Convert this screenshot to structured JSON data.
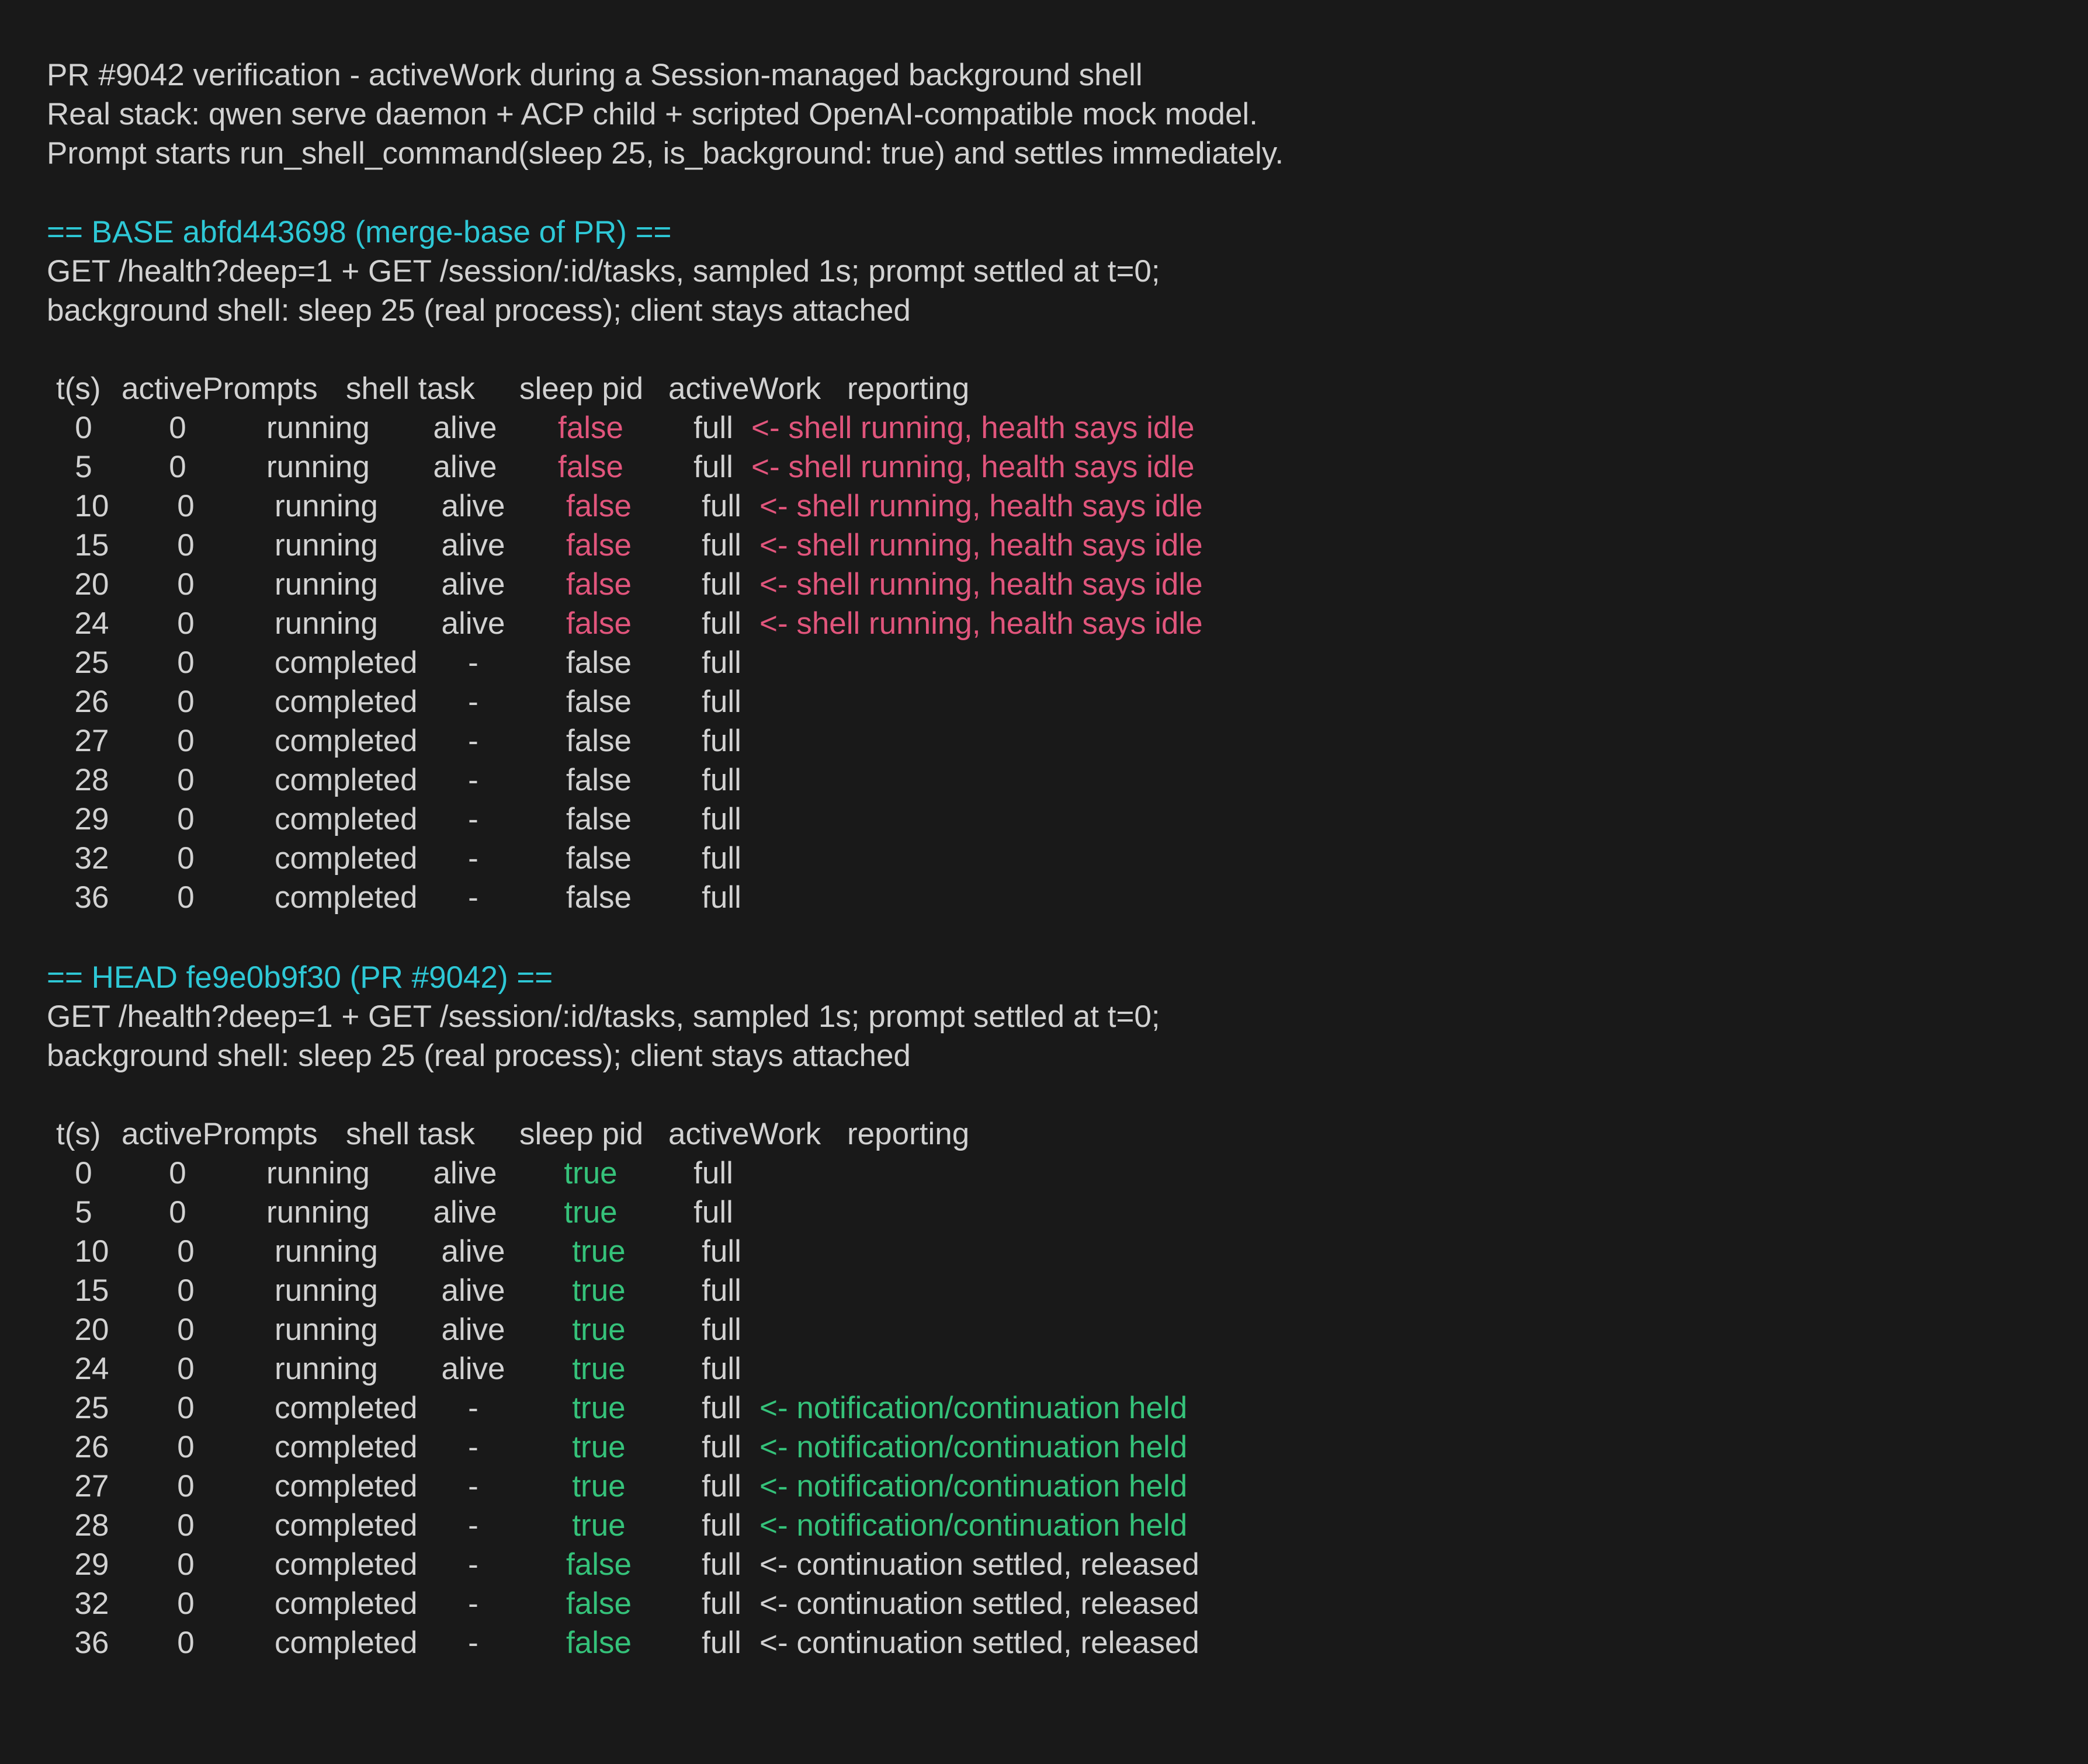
{
  "intro": [
    "PR #9042 verification - activeWork during a Session-managed background shell",
    "Real stack: qwen serve daemon + ACP child + scripted OpenAI-compatible mock model.",
    "Prompt starts run_shell_command(sleep 25, is_background: true) and settles immediately."
  ],
  "colors": {
    "background": "#191919",
    "text": "#d2d2d2",
    "heading": "#2ec8d6",
    "bad": "#e1557c",
    "good": "#35c27a"
  },
  "columns": [
    "t(s)",
    "activePrompts",
    "shell task",
    "sleep pid",
    "activeWork",
    "reporting"
  ],
  "sections": [
    {
      "heading": "== BASE abfd443698 (merge-base of PR) ==",
      "desc": [
        "GET /health?deep=1 + GET /session/:id/tasks, sampled 1s; prompt settled at t=0;",
        "background shell: sleep 25 (real process); client stays attached"
      ],
      "rows": [
        {
          "t": "0",
          "prompts": "0",
          "task": "running",
          "pid": "alive",
          "work": "false",
          "rep": "full",
          "note": "<- shell running, health says idle",
          "workColor": "bad",
          "noteColor": "bad"
        },
        {
          "t": "5",
          "prompts": "0",
          "task": "running",
          "pid": "alive",
          "work": "false",
          "rep": "full",
          "note": "<- shell running, health says idle",
          "workColor": "bad",
          "noteColor": "bad"
        },
        {
          "t": "10",
          "prompts": "0",
          "task": "running",
          "pid": "alive",
          "work": "false",
          "rep": "full",
          "note": "<- shell running, health says idle",
          "workColor": "bad",
          "noteColor": "bad"
        },
        {
          "t": "15",
          "prompts": "0",
          "task": "running",
          "pid": "alive",
          "work": "false",
          "rep": "full",
          "note": "<- shell running, health says idle",
          "workColor": "bad",
          "noteColor": "bad"
        },
        {
          "t": "20",
          "prompts": "0",
          "task": "running",
          "pid": "alive",
          "work": "false",
          "rep": "full",
          "note": "<- shell running, health says idle",
          "workColor": "bad",
          "noteColor": "bad"
        },
        {
          "t": "24",
          "prompts": "0",
          "task": "running",
          "pid": "alive",
          "work": "false",
          "rep": "full",
          "note": "<- shell running, health says idle",
          "workColor": "bad",
          "noteColor": "bad"
        },
        {
          "t": "25",
          "prompts": "0",
          "task": "completed",
          "pid": "-",
          "work": "false",
          "rep": "full",
          "note": "",
          "workColor": "text",
          "noteColor": "text"
        },
        {
          "t": "26",
          "prompts": "0",
          "task": "completed",
          "pid": "-",
          "work": "false",
          "rep": "full",
          "note": "",
          "workColor": "text",
          "noteColor": "text"
        },
        {
          "t": "27",
          "prompts": "0",
          "task": "completed",
          "pid": "-",
          "work": "false",
          "rep": "full",
          "note": "",
          "workColor": "text",
          "noteColor": "text"
        },
        {
          "t": "28",
          "prompts": "0",
          "task": "completed",
          "pid": "-",
          "work": "false",
          "rep": "full",
          "note": "",
          "workColor": "text",
          "noteColor": "text"
        },
        {
          "t": "29",
          "prompts": "0",
          "task": "completed",
          "pid": "-",
          "work": "false",
          "rep": "full",
          "note": "",
          "workColor": "text",
          "noteColor": "text"
        },
        {
          "t": "32",
          "prompts": "0",
          "task": "completed",
          "pid": "-",
          "work": "false",
          "rep": "full",
          "note": "",
          "workColor": "text",
          "noteColor": "text"
        },
        {
          "t": "36",
          "prompts": "0",
          "task": "completed",
          "pid": "-",
          "work": "false",
          "rep": "full",
          "note": "",
          "workColor": "text",
          "noteColor": "text"
        }
      ]
    },
    {
      "heading": "== HEAD fe9e0b9f30 (PR #9042) ==",
      "desc": [
        "GET /health?deep=1 + GET /session/:id/tasks, sampled 1s; prompt settled at t=0;",
        "background shell: sleep 25 (real process); client stays attached"
      ],
      "rows": [
        {
          "t": "0",
          "prompts": "0",
          "task": "running",
          "pid": "alive",
          "work": "true",
          "rep": "full",
          "note": "",
          "workColor": "good",
          "noteColor": "text"
        },
        {
          "t": "5",
          "prompts": "0",
          "task": "running",
          "pid": "alive",
          "work": "true",
          "rep": "full",
          "note": "",
          "workColor": "good",
          "noteColor": "text"
        },
        {
          "t": "10",
          "prompts": "0",
          "task": "running",
          "pid": "alive",
          "work": "true",
          "rep": "full",
          "note": "",
          "workColor": "good",
          "noteColor": "text"
        },
        {
          "t": "15",
          "prompts": "0",
          "task": "running",
          "pid": "alive",
          "work": "true",
          "rep": "full",
          "note": "",
          "workColor": "good",
          "noteColor": "text"
        },
        {
          "t": "20",
          "prompts": "0",
          "task": "running",
          "pid": "alive",
          "work": "true",
          "rep": "full",
          "note": "",
          "workColor": "good",
          "noteColor": "text"
        },
        {
          "t": "24",
          "prompts": "0",
          "task": "running",
          "pid": "alive",
          "work": "true",
          "rep": "full",
          "note": "",
          "workColor": "good",
          "noteColor": "text"
        },
        {
          "t": "25",
          "prompts": "0",
          "task": "completed",
          "pid": "-",
          "work": "true",
          "rep": "full",
          "note": "<- notification/continuation held",
          "workColor": "good",
          "noteColor": "good"
        },
        {
          "t": "26",
          "prompts": "0",
          "task": "completed",
          "pid": "-",
          "work": "true",
          "rep": "full",
          "note": "<- notification/continuation held",
          "workColor": "good",
          "noteColor": "good"
        },
        {
          "t": "27",
          "prompts": "0",
          "task": "completed",
          "pid": "-",
          "work": "true",
          "rep": "full",
          "note": "<- notification/continuation held",
          "workColor": "good",
          "noteColor": "good"
        },
        {
          "t": "28",
          "prompts": "0",
          "task": "completed",
          "pid": "-",
          "work": "true",
          "rep": "full",
          "note": "<- notification/continuation held",
          "workColor": "good",
          "noteColor": "good"
        },
        {
          "t": "29",
          "prompts": "0",
          "task": "completed",
          "pid": "-",
          "work": "false",
          "rep": "full",
          "note": "<- continuation settled, released",
          "workColor": "good",
          "noteColor": "text"
        },
        {
          "t": "32",
          "prompts": "0",
          "task": "completed",
          "pid": "-",
          "work": "false",
          "rep": "full",
          "note": "<- continuation settled, released",
          "workColor": "good",
          "noteColor": "text"
        },
        {
          "t": "36",
          "prompts": "0",
          "task": "completed",
          "pid": "-",
          "work": "false",
          "rep": "full",
          "note": "<- continuation settled, released",
          "workColor": "good",
          "noteColor": "text"
        }
      ]
    }
  ]
}
